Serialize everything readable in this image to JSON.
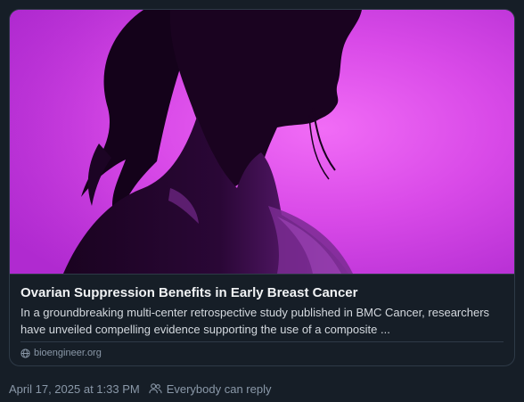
{
  "link_card": {
    "title": "Ovarian Suppression Benefits in Early Breast Cancer",
    "description": "In a groundbreaking multi-center retrospective study published in BMC Cancer, researchers have unveiled compelling evidence supporting the use of a composite ...",
    "domain": "bioengineer.org",
    "domain_icon": "globe-icon",
    "thumbnail_subject": "silhouette of a woman in profile against a magenta background"
  },
  "post_meta": {
    "timestamp": "April 17, 2025 at 1:33 PM",
    "reply_setting": "Everybody can reply",
    "reply_icon": "people-icon"
  },
  "colors": {
    "background": "#161e27",
    "border": "#2e3a47",
    "title": "#f1f3f5",
    "description": "#d4d9df",
    "muted": "#8a98a8",
    "thumbnail_magenta": "#d03ee6"
  }
}
